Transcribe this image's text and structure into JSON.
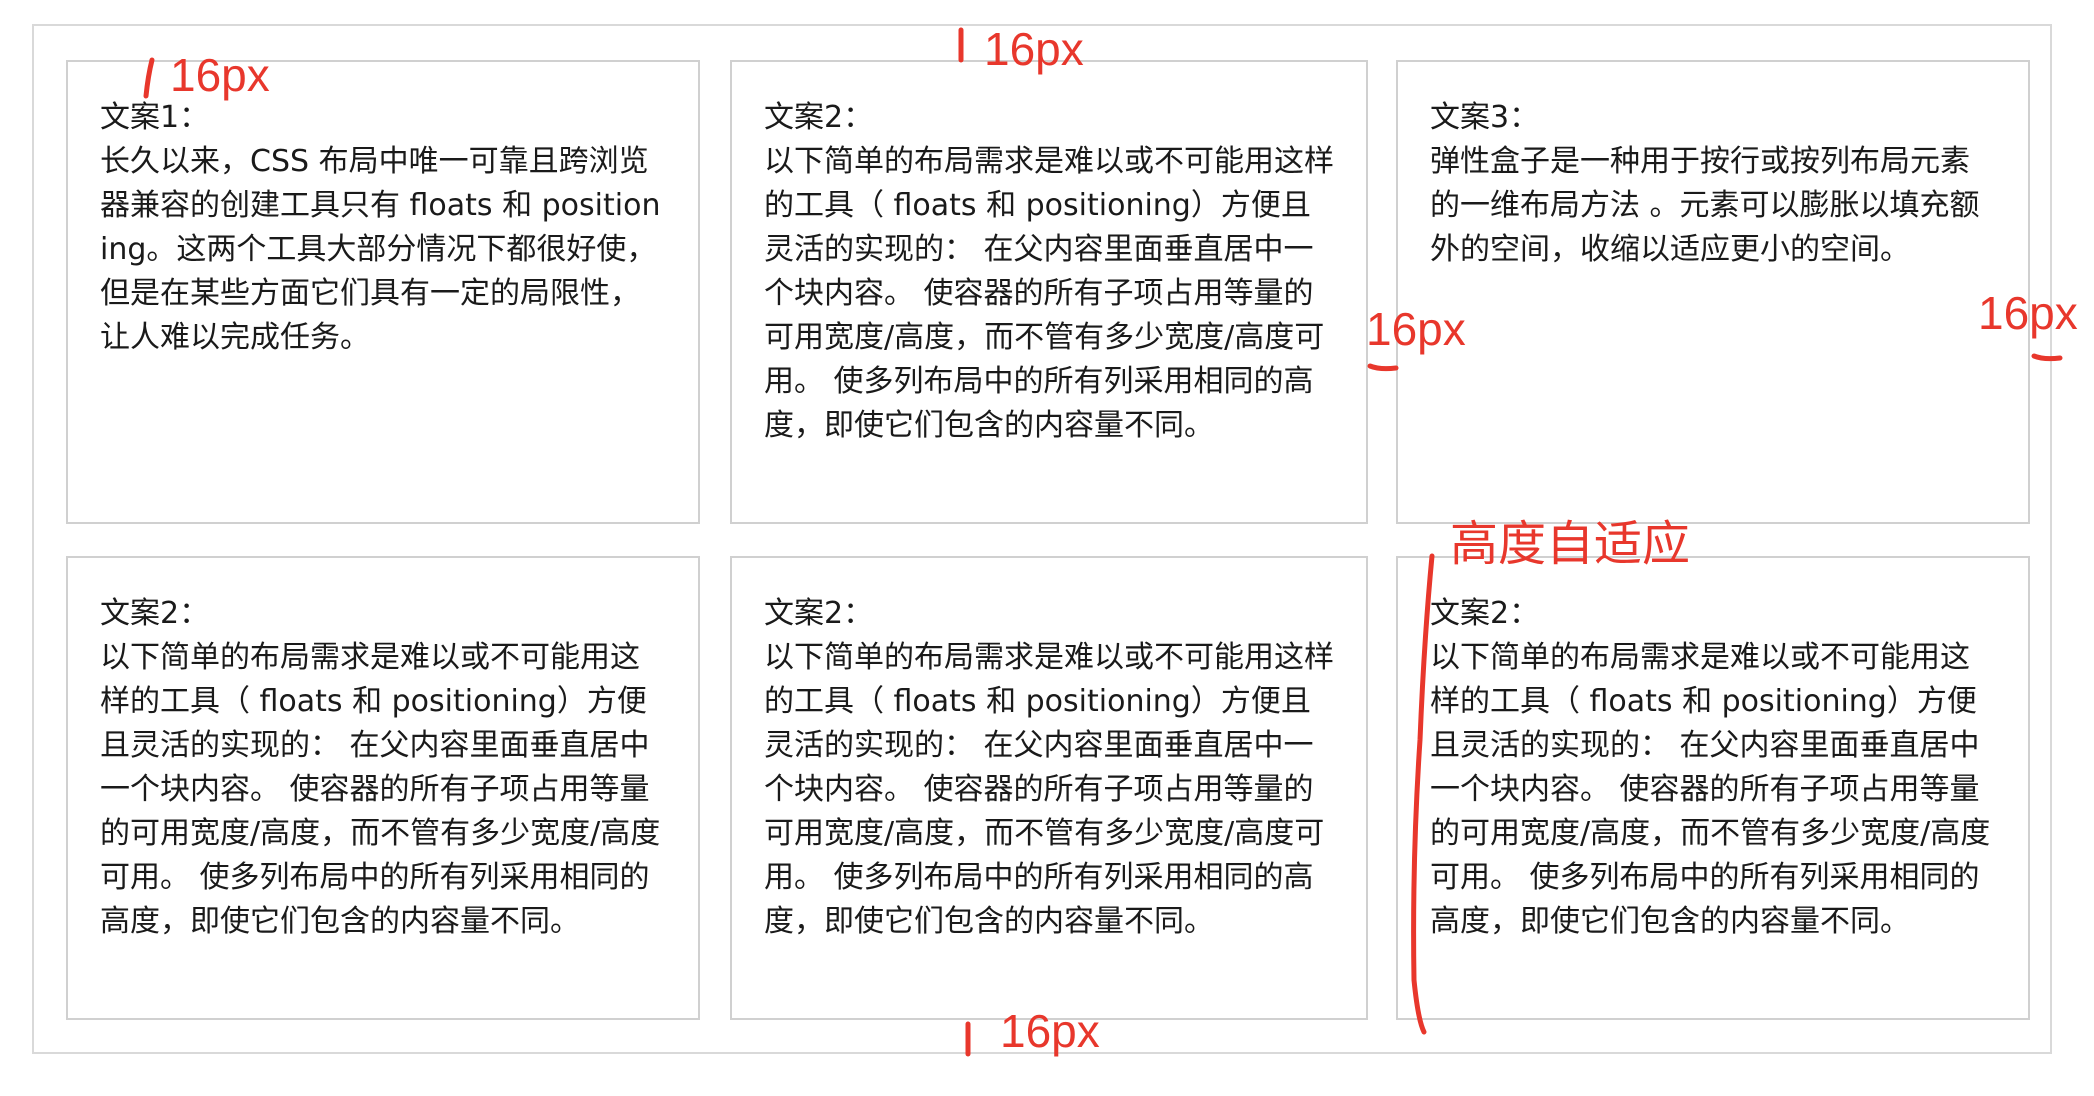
{
  "cards": [
    {
      "title": "文案1：",
      "body": "长久以来，CSS 布局中唯一可靠且跨浏览器兼容的创建工具只有 floats 和 positioning。这两个工具大部分情况下都很好使，但是在某些方面它们具有一定的局限性，让人难以完成任务。"
    },
    {
      "title": "文案2：",
      "body": "以下简单的布局需求是难以或不可能用这样的工具（ floats 和 positioning）方便且灵活的实现的： 在父内容里面垂直居中一个块内容。 使容器的所有子项占用等量的可用宽度/高度，而不管有多少宽度/高度可用。 使多列布局中的所有列采用相同的高度，即使它们包含的内容量不同。"
    },
    {
      "title": "文案3：",
      "body": "弹性盒子是一种用于按行或按列布局元素的一维布局方法 。元素可以膨胀以填充额外的空间，收缩以适应更小的空间。"
    },
    {
      "title": "文案2：",
      "body": "以下简单的布局需求是难以或不可能用这样的工具（ floats 和 positioning）方便且灵活的实现的： 在父内容里面垂直居中一个块内容。 使容器的所有子项占用等量的可用宽度/高度，而不管有多少宽度/高度可用。 使多列布局中的所有列采用相同的高度，即使它们包含的内容量不同。"
    },
    {
      "title": "文案2：",
      "body": "以下简单的布局需求是难以或不可能用这样的工具（ floats 和 positioning）方便且灵活的实现的： 在父内容里面垂直居中一个块内容。 使容器的所有子项占用等量的可用宽度/高度，而不管有多少宽度/高度可用。 使多列布局中的所有列采用相同的高度，即使它们包含的内容量不同。"
    },
    {
      "title": "文案2：",
      "body": "以下简单的布局需求是难以或不可能用这样的工具（ floats 和 positioning）方便且灵活的实现的： 在父内容里面垂直居中一个块内容。 使容器的所有子项占用等量的可用宽度/高度，而不管有多少宽度/高度可用。 使多列布局中的所有列采用相同的高度，即使它们包含的内容量不同。"
    }
  ],
  "annotations": {
    "padding_label": "16px",
    "top_gap_label": "16px",
    "column_gap_label": "16px",
    "right_gap_label": "16px",
    "bottom_gap_label": "16px",
    "height_note": "高度自适应"
  },
  "colors": {
    "annotation": "#e8372c",
    "card_border": "#d0d0d0",
    "container_border": "#d9d9d9",
    "text": "#1a1a1a"
  }
}
